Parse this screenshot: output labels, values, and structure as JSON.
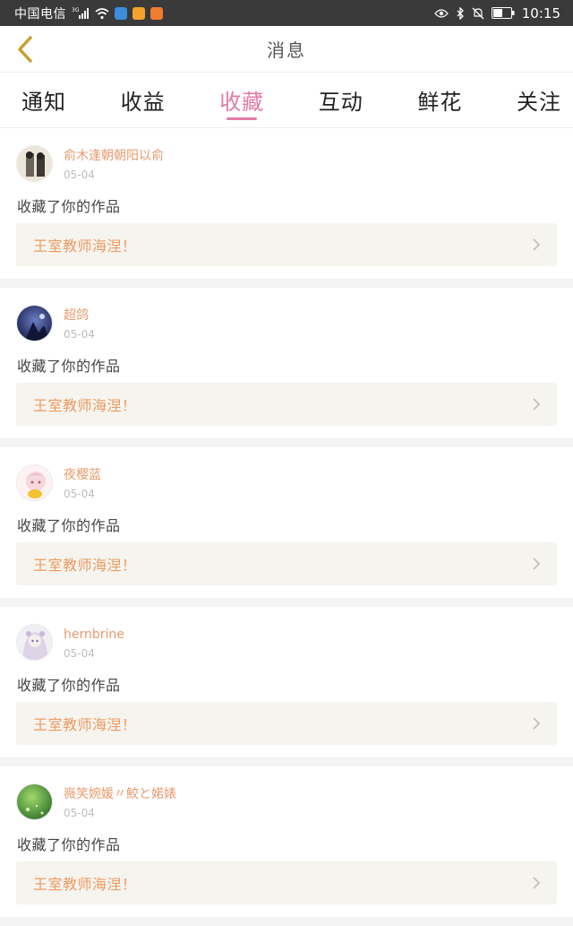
{
  "status_bar": {
    "carrier": "中国电信",
    "network": "3G",
    "time": "10:15",
    "colors": {
      "bg": "#3a3a3a",
      "badge_blue": "#3c8dde",
      "badge_orange": "#f3a32b",
      "badge_orange2": "#ef7c2f"
    }
  },
  "header": {
    "title": "消息",
    "back_icon": "chevron-left-icon",
    "back_color": "#c8a032"
  },
  "tabs": [
    {
      "label": "通知",
      "active": false
    },
    {
      "label": "收益",
      "active": false
    },
    {
      "label": "收藏",
      "active": true
    },
    {
      "label": "互动",
      "active": false
    },
    {
      "label": "鲜花",
      "active": false
    },
    {
      "label": "关注",
      "active": false
    }
  ],
  "accent_color": "#e47aa6",
  "notifications": [
    {
      "username": "俞木逢朝朝阳以俞",
      "date": "05-04",
      "action": "收藏了你的作品",
      "work_title": "王室教师海涅！"
    },
    {
      "username": "超鸽",
      "date": "05-04",
      "action": "收藏了你的作品",
      "work_title": "王室教师海涅！"
    },
    {
      "username": "夜樱蓝",
      "date": "05-04",
      "action": "收藏了你的作品",
      "work_title": "王室教师海涅！"
    },
    {
      "username": "hernbrine",
      "date": "05-04",
      "action": "收藏了你的作品",
      "work_title": "王室教师海涅！"
    },
    {
      "username": "嶶笑婉媛〃鮫と婼婊",
      "date": "05-04",
      "action": "收藏了你的作品",
      "work_title": "王室教师海涅！"
    }
  ]
}
